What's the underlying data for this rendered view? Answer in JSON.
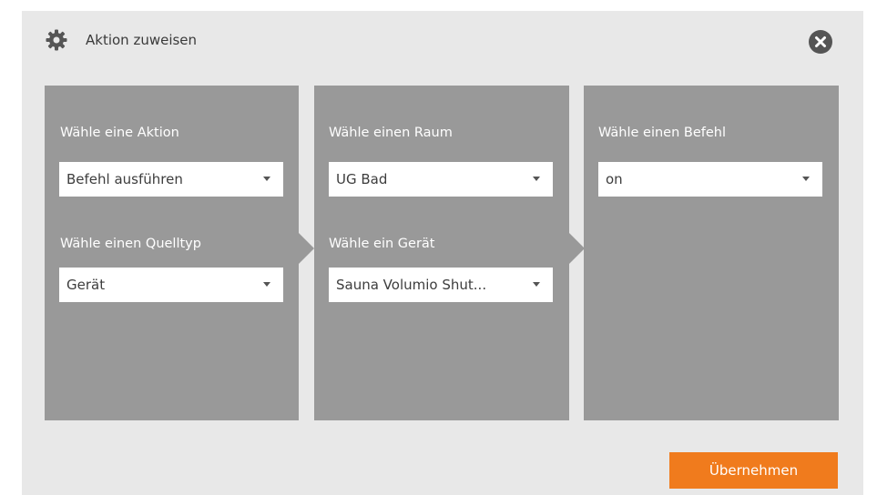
{
  "dialog": {
    "title": "Aktion zuweisen",
    "settings_icon": "gear-icon",
    "close_icon": "close-icon"
  },
  "panels": [
    {
      "fields": [
        {
          "label": "Wähle eine Aktion",
          "value": "Befehl ausführen"
        },
        {
          "label": "Wähle einen Quelltyp",
          "value": "Gerät"
        }
      ]
    },
    {
      "fields": [
        {
          "label": "Wähle einen Raum",
          "value": "UG Bad"
        },
        {
          "label": "Wähle ein Gerät",
          "value": "Sauna Volumio Shut..."
        }
      ]
    },
    {
      "fields": [
        {
          "label": "Wähle einen Befehl",
          "value": "on"
        }
      ]
    }
  ],
  "footer": {
    "apply_label": "Übernehmen"
  },
  "colors": {
    "accent": "#f07b1d",
    "panel": "#999999",
    "background": "#e8e8e8"
  }
}
